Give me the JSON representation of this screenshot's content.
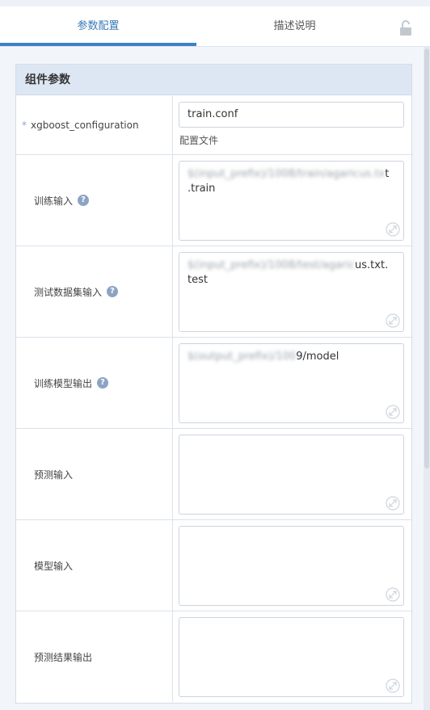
{
  "tabs": [
    {
      "label": "参数配置",
      "active": true
    },
    {
      "label": "描述说明",
      "active": false
    }
  ],
  "panel": {
    "title": "组件参数",
    "rows": [
      {
        "label": "xgboost_configuration",
        "required": true,
        "help": false,
        "value": "train.conf",
        "hint": "配置文件"
      },
      {
        "label": "训练输入",
        "help": true,
        "value_hidden": "$(input_prefix)/1008/train/agaricus.tx",
        "value_visible": "t",
        "value_line2": ".train"
      },
      {
        "label": "测试数据集输入",
        "help": true,
        "value_hidden": "$(input_prefix)/1008/test/agaric",
        "value_visible": "us.txt.",
        "value_line2": "test"
      },
      {
        "label": "训练模型输出",
        "help": true,
        "value_hidden": "$(output_prefix)/100",
        "value_visible": "9/model",
        "value_line2": ""
      },
      {
        "label": "预测输入",
        "help": false,
        "value": ""
      },
      {
        "label": "模型输入",
        "help": false,
        "value": ""
      },
      {
        "label": "预测结果输出",
        "help": false,
        "value": ""
      }
    ]
  },
  "icons": {
    "lock": "lock-icon",
    "help": "question-icon",
    "resize": "resize-icon"
  },
  "colors": {
    "accent": "#3b82c4",
    "header_bg": "#dde7f3"
  }
}
